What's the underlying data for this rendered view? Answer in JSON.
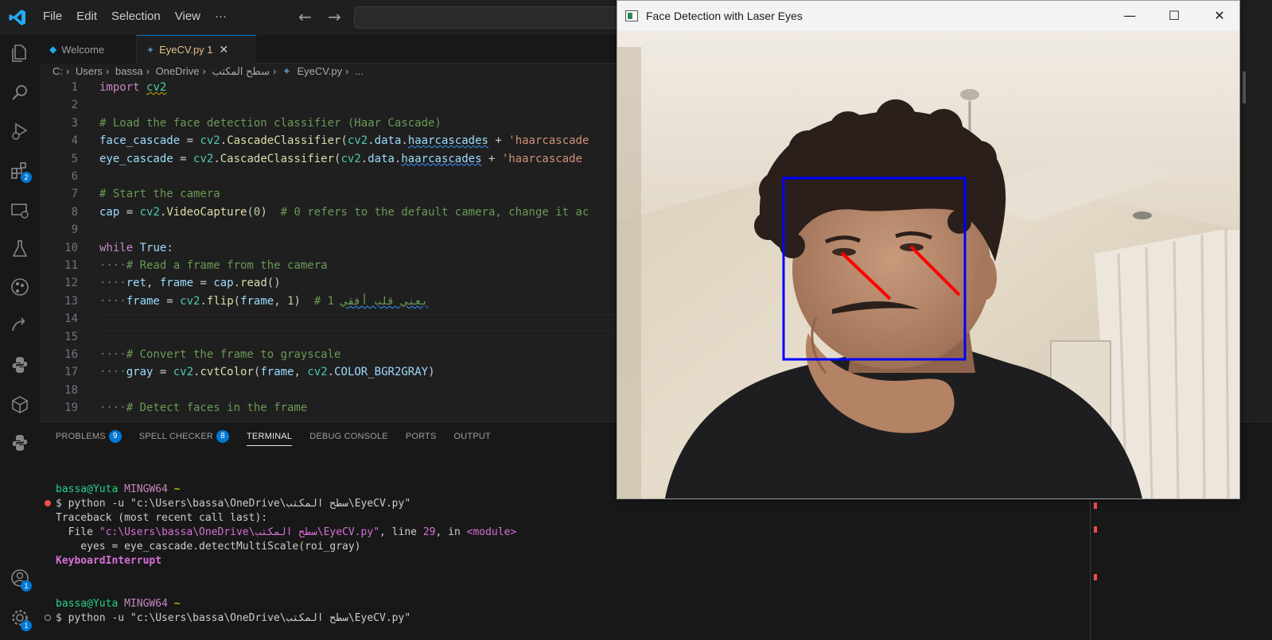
{
  "menu": [
    "File",
    "Edit",
    "Selection",
    "View",
    "···"
  ],
  "activity_badges": {
    "extensions": "2",
    "accounts": "1",
    "manage": "1"
  },
  "tabs": {
    "welcome": "Welcome",
    "active": "EyeCV.py 1"
  },
  "breadcrumb": [
    "C:",
    "Users",
    "bassa",
    "OneDrive",
    "سطح المكتب",
    "EyeCV.py",
    "..."
  ],
  "editor_lines": [
    {
      "n": "1",
      "html": "<span class='kw'>import</span> <span class='cls squigy'>cv2</span>"
    },
    {
      "n": "2",
      "html": ""
    },
    {
      "n": "3",
      "html": "<span class='cm'># Load the face detection classifier (Haar Cascade)</span>"
    },
    {
      "n": "4",
      "html": "<span class='var'>face_cascade</span> = <span class='cls'>cv2</span>.<span class='fn'>CascadeClassifier</span>(<span class='cls'>cv2</span>.<span class='var'>data</span>.<span class='var squig'>haarcascades</span> + <span class='str'>'haarcascade</span>"
    },
    {
      "n": "5",
      "html": "<span class='var'>eye_cascade</span> = <span class='cls'>cv2</span>.<span class='fn'>CascadeClassifier</span>(<span class='cls'>cv2</span>.<span class='var'>data</span>.<span class='var squig'>haarcascades</span> + <span class='str'>'haarcascade</span>"
    },
    {
      "n": "6",
      "html": ""
    },
    {
      "n": "7",
      "html": "<span class='cm'># Start the camera</span>"
    },
    {
      "n": "8",
      "html": "<span class='var'>cap</span> = <span class='cls'>cv2</span>.<span class='fn'>VideoCapture</span>(<span class='num'>0</span>)  <span class='cm'># 0 refers to the default camera, change it ac</span>"
    },
    {
      "n": "9",
      "html": ""
    },
    {
      "n": "10",
      "html": "<span class='kw'>while</span> <span class='var'>True</span>:"
    },
    {
      "n": "11",
      "html": "<span class='dim'>····</span><span class='cm'># Read a frame from the camera</span>"
    },
    {
      "n": "12",
      "html": "<span class='dim'>····</span><span class='var'>ret</span>, <span class='var'>frame</span> = <span class='var'>cap</span>.<span class='fn'>read</span>()"
    },
    {
      "n": "13",
      "html": "<span class='dim'>····</span><span class='var'>frame</span> = <span class='cls'>cv2</span>.<span class='fn'>flip</span>(<span class='var'>frame</span>, <span class='num'>1</span>)  <span class='cm'># 1 <span class='squig'>يعني قلب أفقي</span></span>"
    },
    {
      "n": "14",
      "html": ""
    },
    {
      "n": "15",
      "html": ""
    },
    {
      "n": "16",
      "html": "<span class='dim'>····</span><span class='cm'># Convert the frame to grayscale</span>"
    },
    {
      "n": "17",
      "html": "<span class='dim'>····</span><span class='var'>gray</span> = <span class='cls'>cv2</span>.<span class='fn'>cvtColor</span>(<span class='var'>frame</span>, <span class='cls'>cv2</span>.<span class='var'>COLOR_BGR2GRAY</span>)"
    },
    {
      "n": "18",
      "html": ""
    },
    {
      "n": "19",
      "html": "<span class='dim'>····</span><span class='cm'># Detect faces in the frame</span>"
    }
  ],
  "panel": {
    "tabs": [
      {
        "label": "PROBLEMS",
        "badge": "9"
      },
      {
        "label": "SPELL CHECKER",
        "badge": "8"
      },
      {
        "label": "TERMINAL",
        "badge": ""
      },
      {
        "label": "DEBUG CONSOLE",
        "badge": ""
      },
      {
        "label": "PORTS",
        "badge": ""
      },
      {
        "label": "OUTPUT",
        "badge": ""
      }
    ],
    "active_tab": "TERMINAL"
  },
  "terminal_lines": [
    {
      "html": "<span class='green'>bassa@Yuta</span> <span class='purple'>MINGW64</span> <span class='yel'>~</span>"
    },
    {
      "html": "$ python -u \"c:\\Users\\bassa\\OneDrive\\سطح المكتب\\EyeCV.py\""
    },
    {
      "html": "Traceback (most recent call last):"
    },
    {
      "html": "  File <span class='mag'>\"c:\\Users\\bassa\\OneDrive\\سطح المكتب\\EyeCV.py\"</span>, line <span class='mag'>29</span>, in <span class='mag'>&lt;module&gt;</span>"
    },
    {
      "html": "    eyes = eye_cascade.detectMultiScale(roi_gray)"
    },
    {
      "html": "<span class='mag'><b>KeyboardInterrupt</b></span>"
    },
    {
      "html": ""
    },
    {
      "html": ""
    },
    {
      "html": "<span class='green'>bassa@Yuta</span> <span class='purple'>MINGW64</span> <span class='yel'>~</span>"
    },
    {
      "html": "$ python -u \"c:\\Users\\bassa\\OneDrive\\سطح المكتب\\EyeCV.py\""
    }
  ],
  "camera_window": {
    "title": "Face Detection with Laser Eyes"
  },
  "colors": {
    "accent": "#0078d4",
    "face_box": "#0000ff",
    "laser": "#ff0000"
  }
}
